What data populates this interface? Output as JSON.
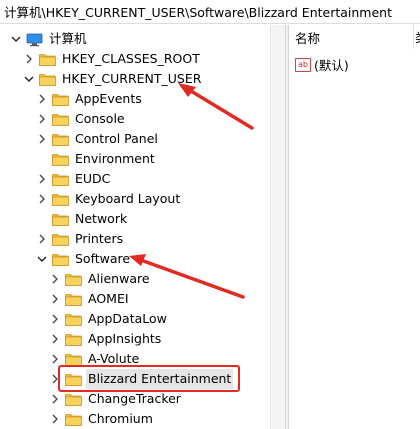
{
  "address_path": "计算机\\HKEY_CURRENT_USER\\Software\\Blizzard Entertainment",
  "tree": {
    "root": "计算机",
    "hkcr": "HKEY_CLASSES_ROOT",
    "hkcu": "HKEY_CURRENT_USER",
    "hkcu_children": [
      "AppEvents",
      "Console",
      "Control Panel",
      "Environment",
      "EUDC",
      "Keyboard Layout",
      "Network",
      "Printers"
    ],
    "software": "Software",
    "software_children": [
      "Alienware",
      "AOMEI",
      "AppDataLow",
      "AppInsights",
      "A-Volute",
      "Blizzard Entertainment",
      "ChangeTracker",
      "Chromium"
    ]
  },
  "values_pane": {
    "name_header": "名称",
    "type_header_partial": "类",
    "default_value": "(默认)",
    "default_icon": "ab"
  },
  "colors": {
    "annotation_red": "#e02a22",
    "folder_yellow": "#f3c53f",
    "selection_gray": "#e5e5e5"
  },
  "icons": {
    "computer": "computer-icon",
    "folder": "folder-icon",
    "chevron_right": "chevron-right-icon",
    "chevron_down": "chevron-down-icon"
  }
}
